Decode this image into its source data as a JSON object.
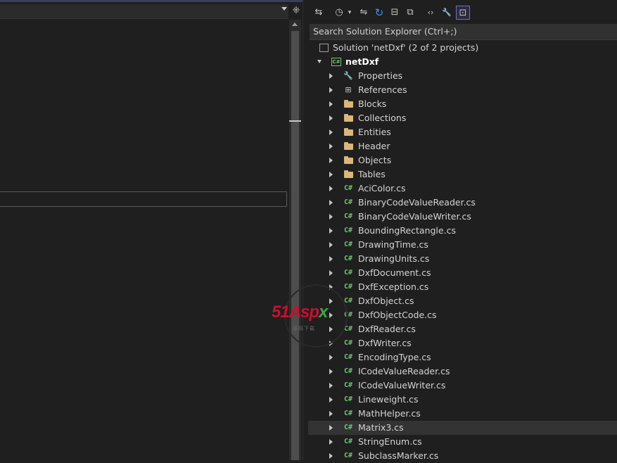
{
  "toolbar": {
    "buttons": [
      {
        "name": "sync-with-active-document-icon",
        "glyph": "⇆"
      },
      {
        "name": "pending-changes-filter-icon",
        "glyph": "◷"
      },
      {
        "name": "dropdown-arrow-icon",
        "glyph": "▾"
      },
      {
        "name": "switch-views-icon",
        "glyph": "⇋"
      },
      {
        "name": "refresh-icon",
        "glyph": "↻"
      },
      {
        "name": "collapse-all-icon",
        "glyph": "⊟"
      },
      {
        "name": "show-all-files-icon",
        "glyph": "⧉"
      },
      {
        "name": "view-code-icon",
        "glyph": "‹›"
      },
      {
        "name": "properties-wrench-icon",
        "glyph": "🔧"
      },
      {
        "name": "preview-selected-items-icon",
        "glyph": "⊡"
      }
    ]
  },
  "search": {
    "placeholder": "Search Solution Explorer (Ctrl+;)"
  },
  "solution": {
    "label": "Solution 'netDxf' (2 of 2 projects)"
  },
  "project": {
    "label": "netDxf"
  },
  "items": [
    {
      "label": "Properties",
      "icon": "wrench-icon"
    },
    {
      "label": "References",
      "icon": "references-icon"
    },
    {
      "label": "Blocks",
      "icon": "folder-icon"
    },
    {
      "label": "Collections",
      "icon": "folder-icon"
    },
    {
      "label": "Entities",
      "icon": "folder-icon"
    },
    {
      "label": "Header",
      "icon": "folder-icon"
    },
    {
      "label": "Objects",
      "icon": "folder-icon"
    },
    {
      "label": "Tables",
      "icon": "folder-icon"
    },
    {
      "label": "AciColor.cs",
      "icon": "csharp-file-icon"
    },
    {
      "label": "BinaryCodeValueReader.cs",
      "icon": "csharp-file-icon"
    },
    {
      "label": "BinaryCodeValueWriter.cs",
      "icon": "csharp-file-icon"
    },
    {
      "label": "BoundingRectangle.cs",
      "icon": "csharp-file-icon"
    },
    {
      "label": "DrawingTime.cs",
      "icon": "csharp-file-icon"
    },
    {
      "label": "DrawingUnits.cs",
      "icon": "csharp-file-icon"
    },
    {
      "label": "DxfDocument.cs",
      "icon": "csharp-file-icon"
    },
    {
      "label": "DxfException.cs",
      "icon": "csharp-file-icon"
    },
    {
      "label": "DxfObject.cs",
      "icon": "csharp-file-icon"
    },
    {
      "label": "DxfObjectCode.cs",
      "icon": "csharp-file-icon"
    },
    {
      "label": "DxfReader.cs",
      "icon": "csharp-file-icon"
    },
    {
      "label": "DxfWriter.cs",
      "icon": "csharp-file-icon"
    },
    {
      "label": "EncodingType.cs",
      "icon": "csharp-file-icon"
    },
    {
      "label": "ICodeValueReader.cs",
      "icon": "csharp-file-icon"
    },
    {
      "label": "ICodeValueWriter.cs",
      "icon": "csharp-file-icon"
    },
    {
      "label": "Lineweight.cs",
      "icon": "csharp-file-icon"
    },
    {
      "label": "MathHelper.cs",
      "icon": "csharp-file-icon"
    },
    {
      "label": "Matrix3.cs",
      "icon": "csharp-file-icon",
      "selected": true
    },
    {
      "label": "StringEnum.cs",
      "icon": "csharp-file-icon"
    },
    {
      "label": "SubclassMarker.cs",
      "icon": "csharp-file-icon"
    }
  ],
  "watermark": {
    "main": "51Asp",
    "accent": "x",
    "sub": "源码下载"
  },
  "colors": {
    "csharp": "#6cc86c",
    "folder": "#dcb67a",
    "selection": "#333333",
    "accent": "#6d6dd0"
  }
}
